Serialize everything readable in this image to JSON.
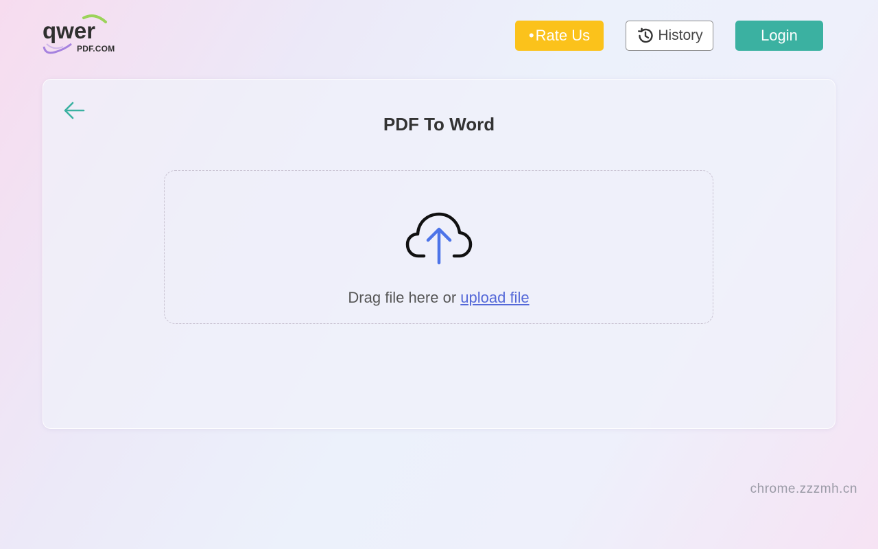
{
  "logo": {
    "word": "qwer",
    "sub": "PDF.COM",
    "accent_color": "#9bd35a",
    "deco_color": "#8b63d8"
  },
  "header": {
    "rate_label": "Rate Us",
    "rate_dot": "•",
    "history_label": "History",
    "login_label": "Login",
    "rate_color": "#fbc21b",
    "login_color": "#3bb1a1"
  },
  "card": {
    "title": "PDF To Word",
    "drop_text_prefix": "Drag file here or ",
    "upload_link": "upload file"
  },
  "icons": {
    "back": "arrow-left-icon",
    "history": "history-clock-icon",
    "upload": "cloud-upload-icon"
  },
  "watermark": "chrome.zzzmh.cn"
}
